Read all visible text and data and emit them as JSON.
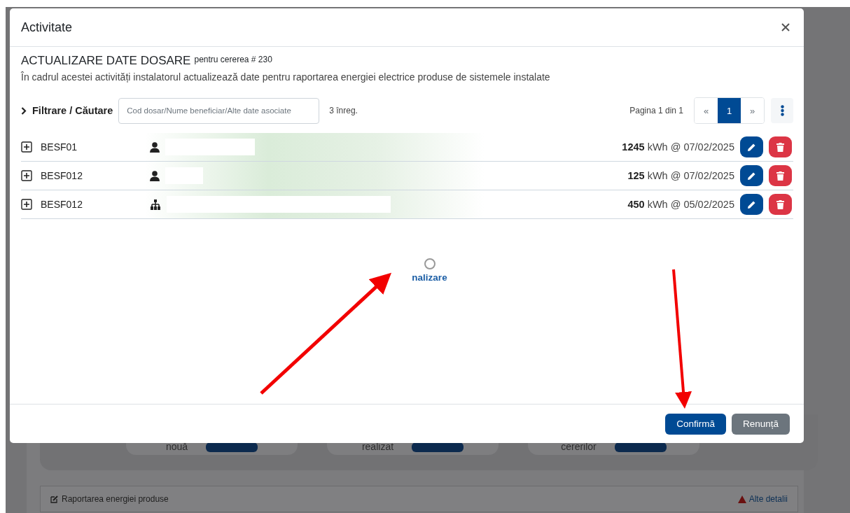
{
  "window": {
    "title": "Activitate"
  },
  "heading": {
    "title": "ACTUALIZARE DATE DOSARE",
    "suffix": "pentru cererea # 230",
    "description": "În cadrul acestei activități instalatorul actualizează date pentru raportarea energiei electrice produse de sistemele instalate"
  },
  "filter": {
    "label": "Filtrare / Căutare",
    "expanded": false,
    "placeholder": "Cod dosar/Nume beneficiar/Alte date asociate",
    "count": "3 înreg."
  },
  "pagination": {
    "info": "Pagina 1 din 1",
    "first": "«",
    "pages": [
      {
        "label": "1",
        "selected": true
      }
    ],
    "last": "»"
  },
  "rows": [
    {
      "code": "BESF01",
      "kind": "person",
      "reading": "**1245** kWh @ 07/02/2025"
    },
    {
      "code": "BESF012",
      "kind": "person",
      "reading": "**125** kWh @ 07/02/2025"
    },
    {
      "code": "BESF012",
      "kind": "organization",
      "reading": "**450** kWh @ 05/02/2025"
    }
  ],
  "action": {
    "label": "nalizare",
    "checked": false
  },
  "buttons": [
    {
      "label": "Confirmă",
      "kind": "primary"
    },
    {
      "label": "Renunță",
      "kind": "secondary"
    }
  ],
  "background": {
    "cards": [
      {
        "label": "nouă"
      },
      {
        "label": "realizat"
      },
      {
        "label": "cererilor"
      }
    ],
    "section": {
      "title": "Raportarea energiei produse",
      "link": "Alte detalii"
    }
  }
}
